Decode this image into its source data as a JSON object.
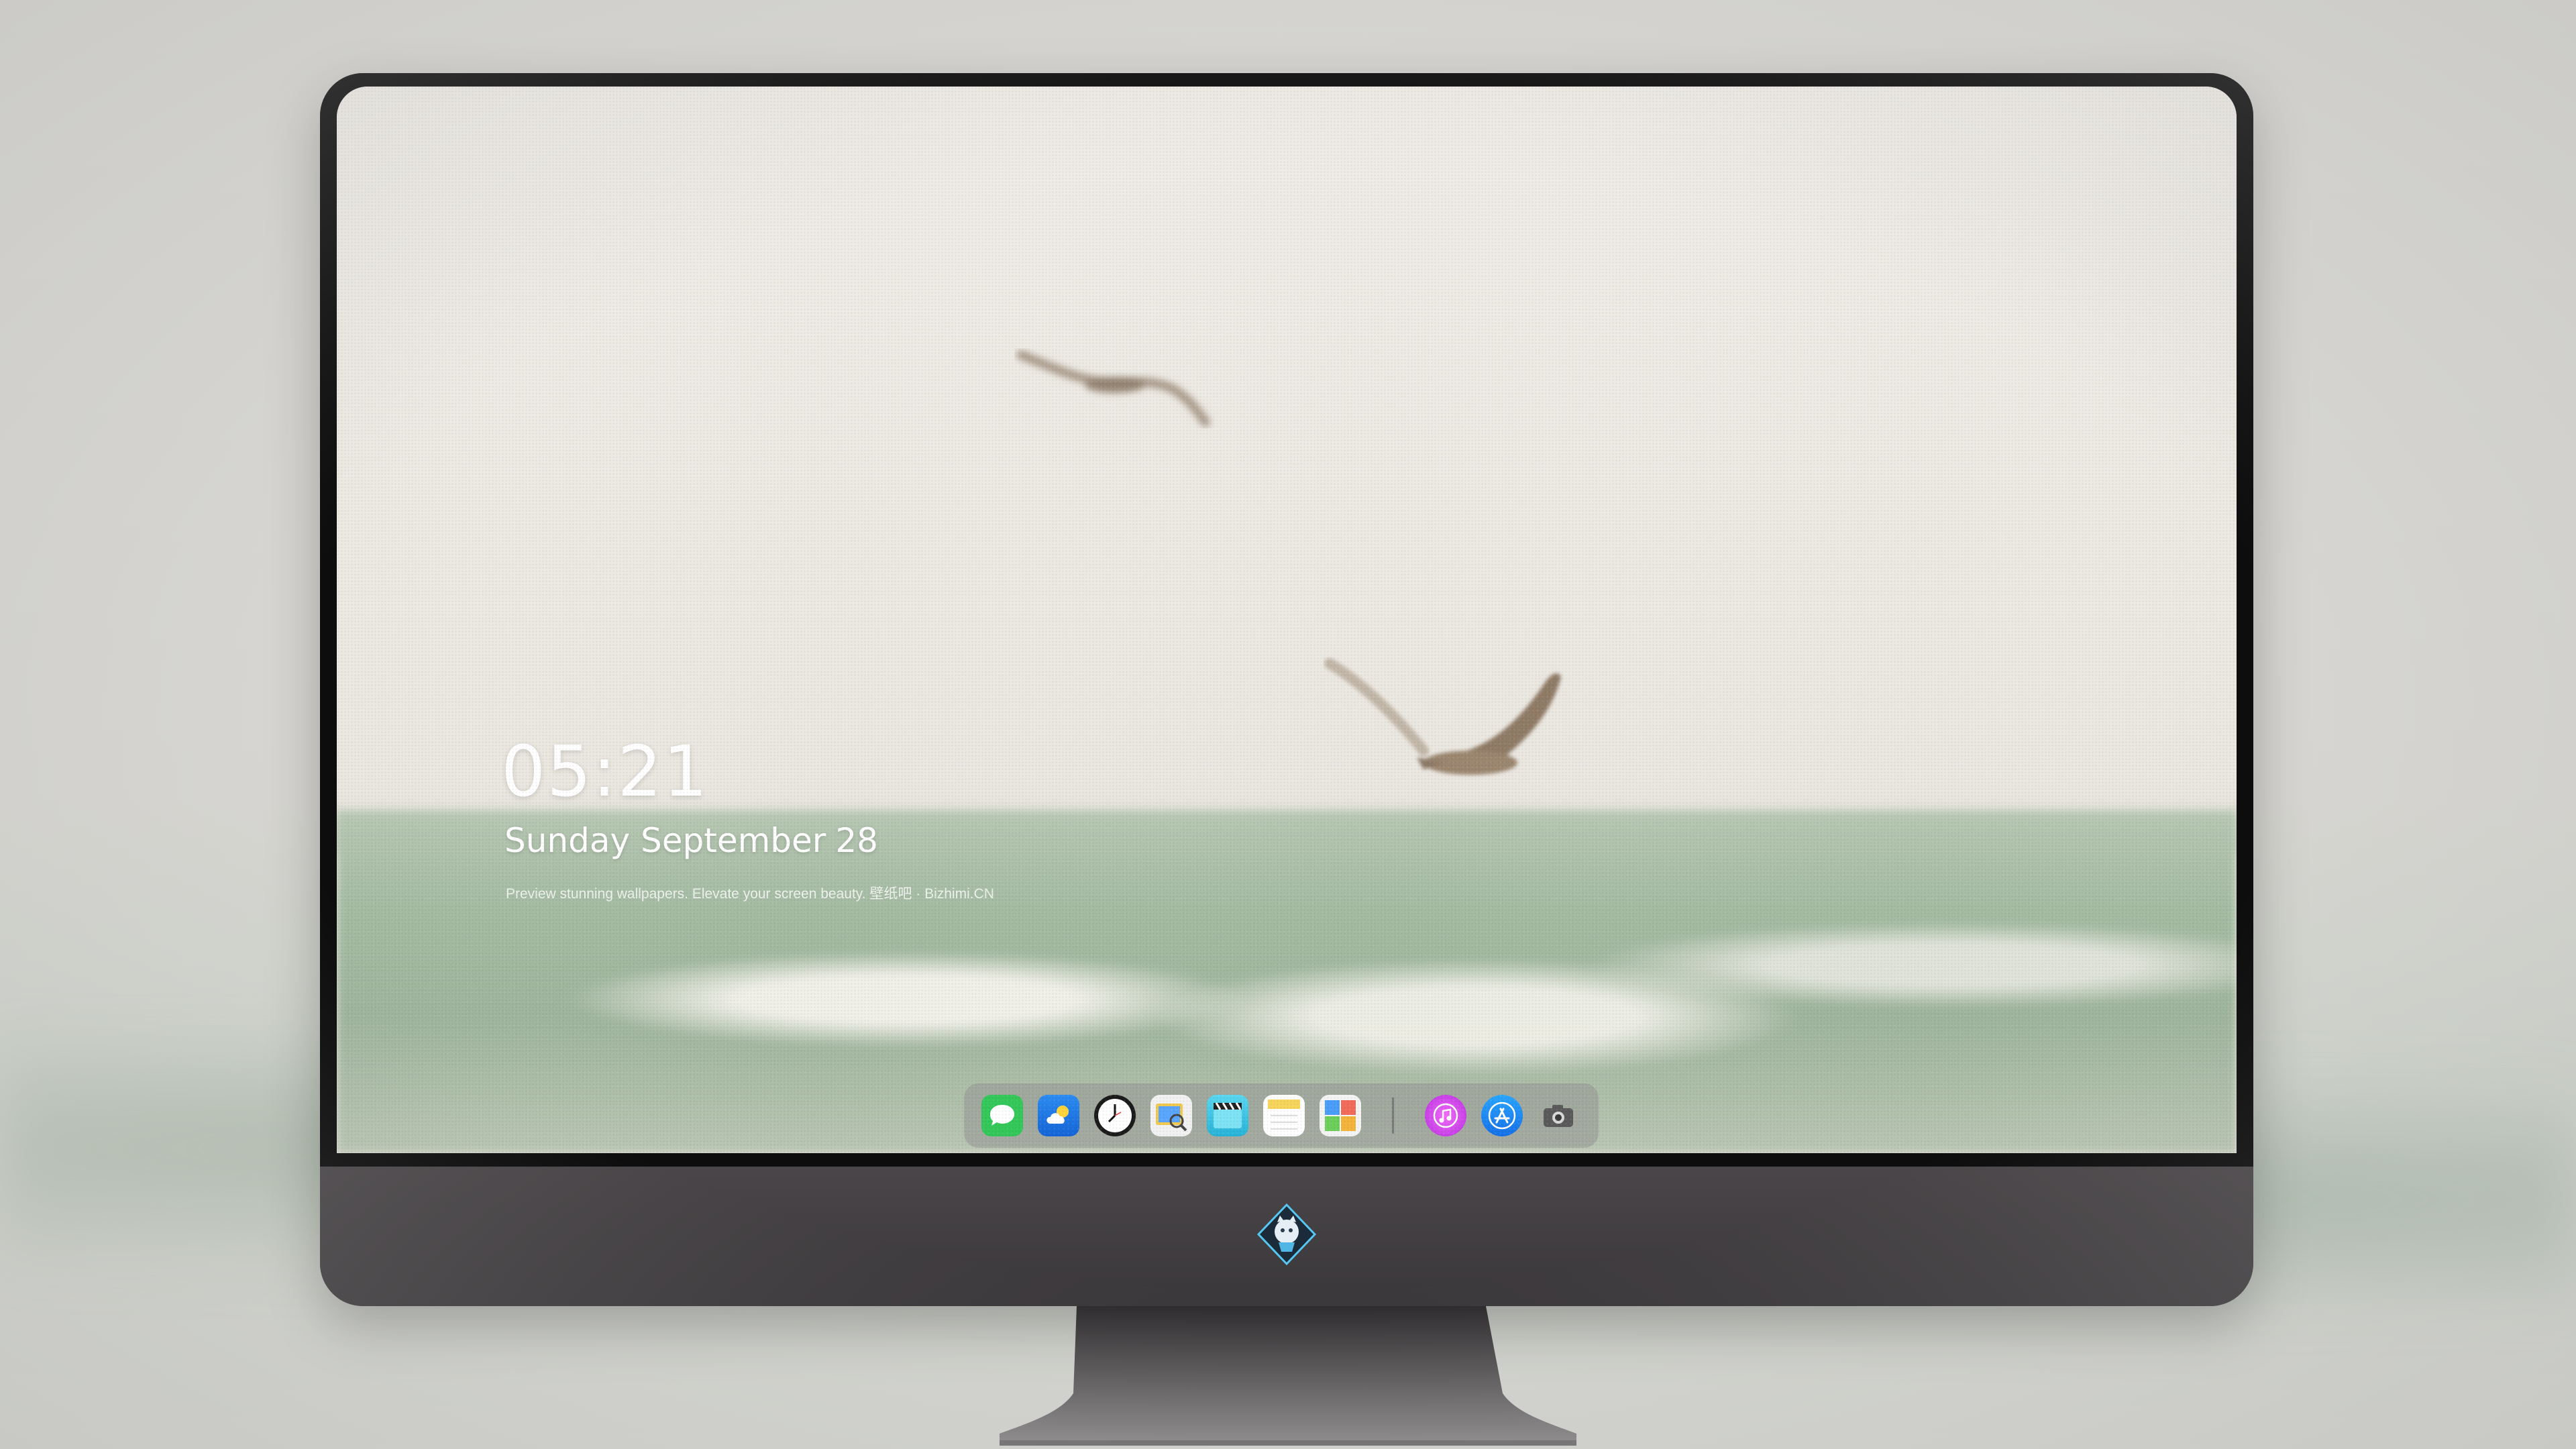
{
  "lock_screen": {
    "time": "05:21",
    "date": {
      "weekday_month": "Sunday September",
      "day": "28"
    },
    "tagline": "Preview stunning wallpapers. Elevate your screen beauty. 壁纸吧 · Bizhimi.CN"
  },
  "dock": {
    "apps": [
      {
        "name": "Messages",
        "icon": "chat-bubble-icon",
        "color": "#34c759"
      },
      {
        "name": "Weather",
        "icon": "cloud-sun-icon",
        "color": "#1e7bf0"
      },
      {
        "name": "Clock",
        "icon": "clock-icon",
        "color": "#1b1b1b"
      },
      {
        "name": "Preview",
        "icon": "photo-magnifier-icon",
        "color": "#f2c94c"
      },
      {
        "name": "Clips",
        "icon": "clapperboard-icon",
        "color": "#38c8e6"
      },
      {
        "name": "Notes",
        "icon": "notepad-icon",
        "color": "#f7d55b"
      },
      {
        "name": "Photo Booth",
        "icon": "photo-grid-icon",
        "color": "#ffffff"
      },
      {
        "name": "iTunes",
        "icon": "music-note-icon",
        "color": "#d33ef2"
      },
      {
        "name": "App Store",
        "icon": "app-store-icon",
        "color": "#1a8cff"
      },
      {
        "name": "Camera",
        "icon": "camera-icon",
        "color": "#5a5a5a"
      }
    ]
  },
  "colors": {
    "bezel": "#0d0d0e",
    "chin": "#403c3f",
    "sky": "#ece9e2",
    "sea": "#a4bba2"
  }
}
